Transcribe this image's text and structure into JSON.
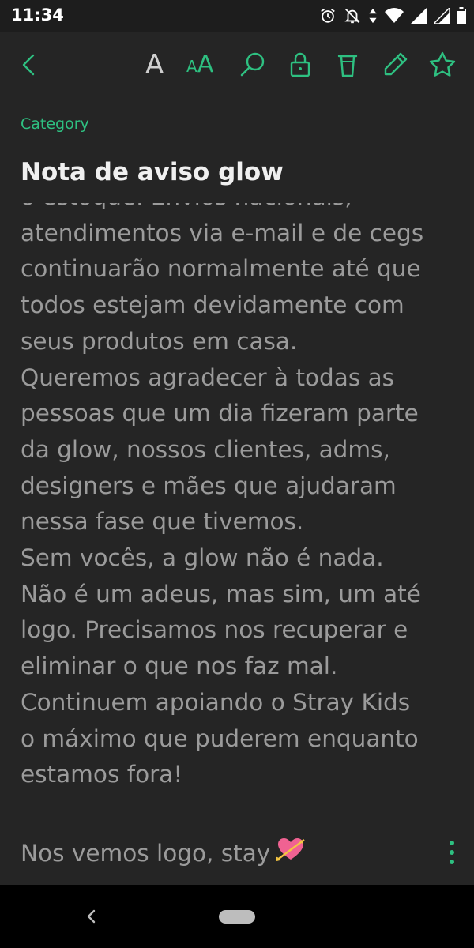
{
  "status_bar": {
    "time": "11:34",
    "icons": [
      "alarm-icon",
      "notifications-off-icon",
      "data-arrows-icon",
      "wifi-icon",
      "signal-icon",
      "signal-icon",
      "battery-icon"
    ]
  },
  "toolbar": {
    "font_a": "A",
    "font_aa_small": "A",
    "font_aa_big": "A",
    "icons": [
      "back-icon",
      "search-icon",
      "lock-icon",
      "trash-icon",
      "edit-icon",
      "star-icon"
    ]
  },
  "note": {
    "category": "Category",
    "title": "Nota de aviso glow",
    "lines": [
      "o estoque. Envios nacionais,",
      "atendimentos via e-mail e de cegs",
      "continuarão normalmente até que",
      "todos estejam devidamente com",
      "seus produtos em casa.",
      "Queremos agradecer à todas as",
      "pessoas que um dia fizeram parte",
      "da glow, nossos clientes, adms,",
      "designers e mães que ajudaram",
      "nessa fase que tivemos.",
      "Sem vocês, a glow não é nada.",
      "Não é um adeus, mas sim, um até",
      "logo. Precisamos nos recuperar e",
      "eliminar o que nos faz mal.",
      "Continuem apoiando o Stray Kids",
      "o máximo que puderem enquanto",
      "estamos fora!"
    ],
    "last_line": "Nos vemos logo, stay"
  },
  "colors": {
    "accent": "#2ec081",
    "background": "#252525",
    "text": "#9b9b9b",
    "title": "#f0f0f0"
  }
}
